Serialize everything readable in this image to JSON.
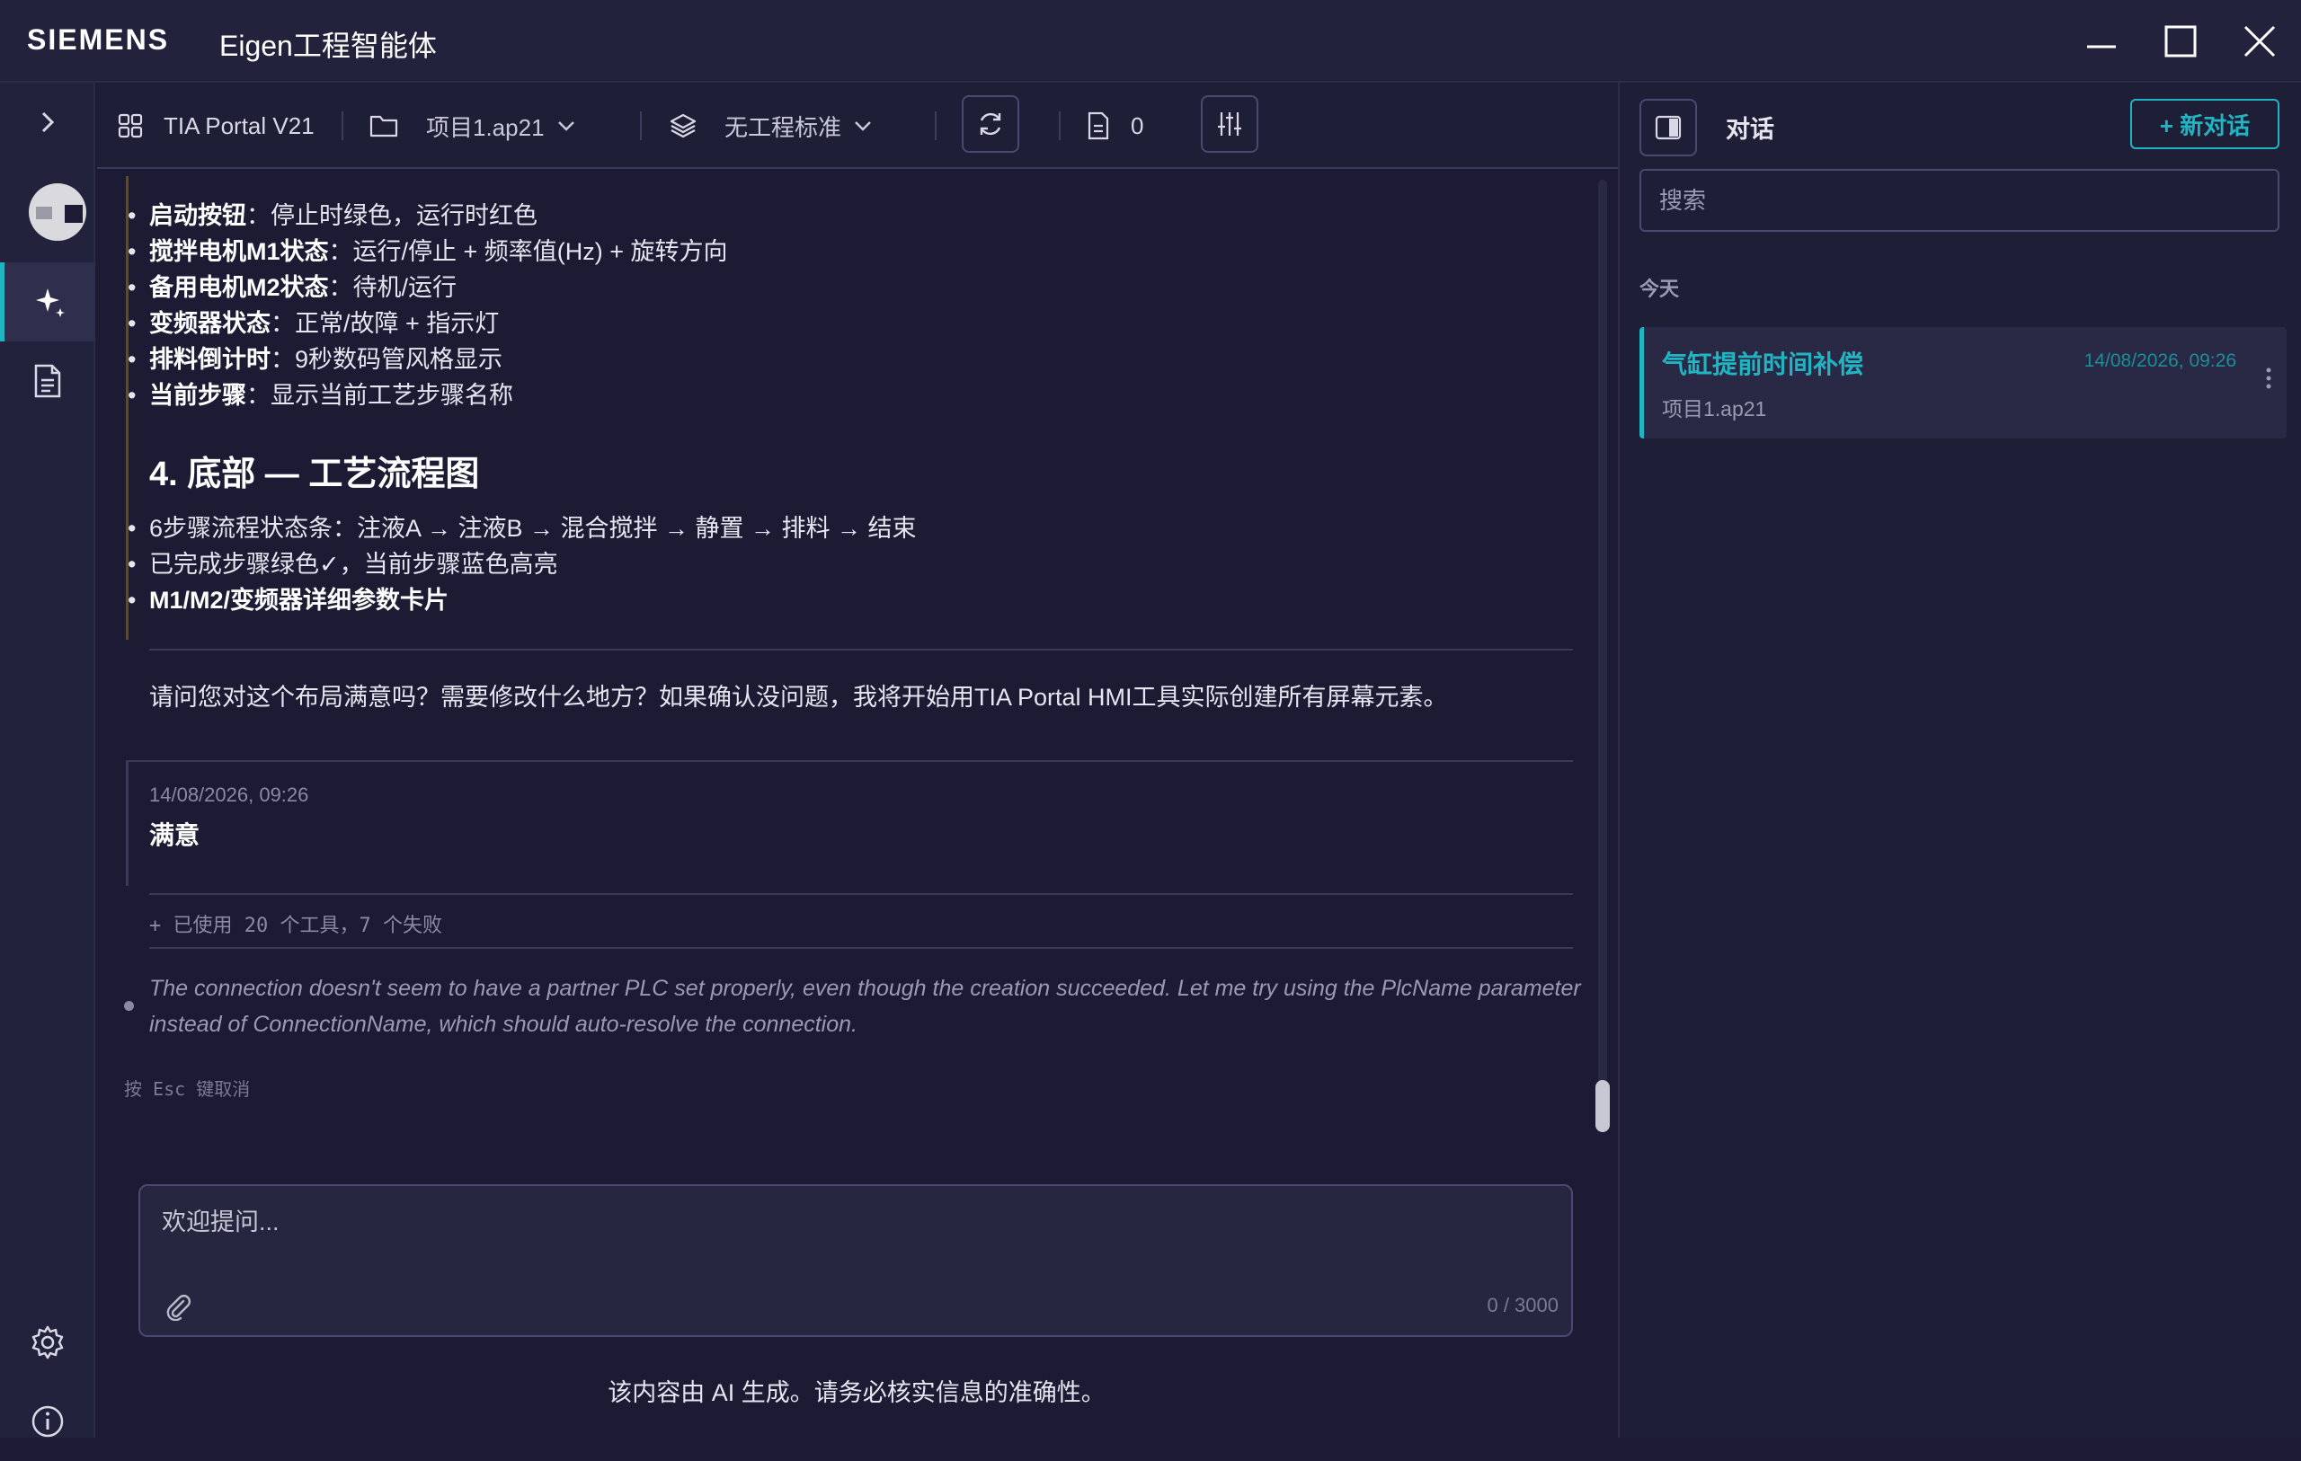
{
  "titlebar": {
    "brand": "SIEMENS",
    "app_title": "Eigen工程智能体"
  },
  "toolbar": {
    "portal": "TIA Portal V21",
    "project": "项目1.ap21",
    "standard": "无工程标准",
    "doc_count": "0"
  },
  "message": {
    "bullets_top": [
      {
        "bold": "启动按钮",
        "text": "：停止时绿色，运行时红色"
      },
      {
        "bold": "搅拌电机M1状态",
        "text": "：运行/停止 + 频率值(Hz) + 旋转方向"
      },
      {
        "bold": "备用电机M2状态",
        "text": "：待机/运行"
      },
      {
        "bold": "变频器状态",
        "text": "：正常/故障 + 指示灯"
      },
      {
        "bold": "排料倒计时",
        "text": "：9秒数码管风格显示"
      },
      {
        "bold": "当前步骤",
        "text": "：显示当前工艺步骤名称"
      }
    ],
    "section_heading": "4. 底部 — 工艺流程图",
    "bullets_bottom": [
      {
        "bold": "",
        "text": "6步骤流程状态条：注液A → 注液B → 混合搅拌 → 静置 → 排料 → 结束"
      },
      {
        "bold": "",
        "text": "已完成步骤绿色✓，当前步骤蓝色高亮"
      },
      {
        "bold": "M1/M2/变频器详细参数卡片",
        "text": ""
      }
    ],
    "question": "请问您对这个布局满意吗？需要修改什么地方？如果确认没问题，我将开始用TIA Portal HMI工具实际创建所有屏幕元素。"
  },
  "user_reply": {
    "timestamp": "14/08/2026, 09:26",
    "text": "满意"
  },
  "tools_summary": "+ 已使用 20 个工具，7 个失败",
  "thinking": "The connection doesn't seem to have a partner PLC set properly, even though the creation succeeded. Let me try using the PlcName parameter instead of ConnectionName, which should auto-resolve the connection.",
  "esc_hint": "按 Esc 键取消",
  "input": {
    "placeholder": "欢迎提问...",
    "counter": "0 / 3000"
  },
  "disclaimer": "该内容由 AI 生成。请务必核实信息的准确性。",
  "right_panel": {
    "title": "对话",
    "new_chat": "+ 新对话",
    "search_placeholder": "搜索",
    "group_label": "今天",
    "conversations": [
      {
        "title": "气缸提前时间补偿",
        "time": "14/08/2026, 09:26",
        "project": "项目1.ap21"
      }
    ]
  },
  "colors": {
    "accent": "#1fb5c2",
    "background": "#1c1b33",
    "panel": "#23223c"
  }
}
